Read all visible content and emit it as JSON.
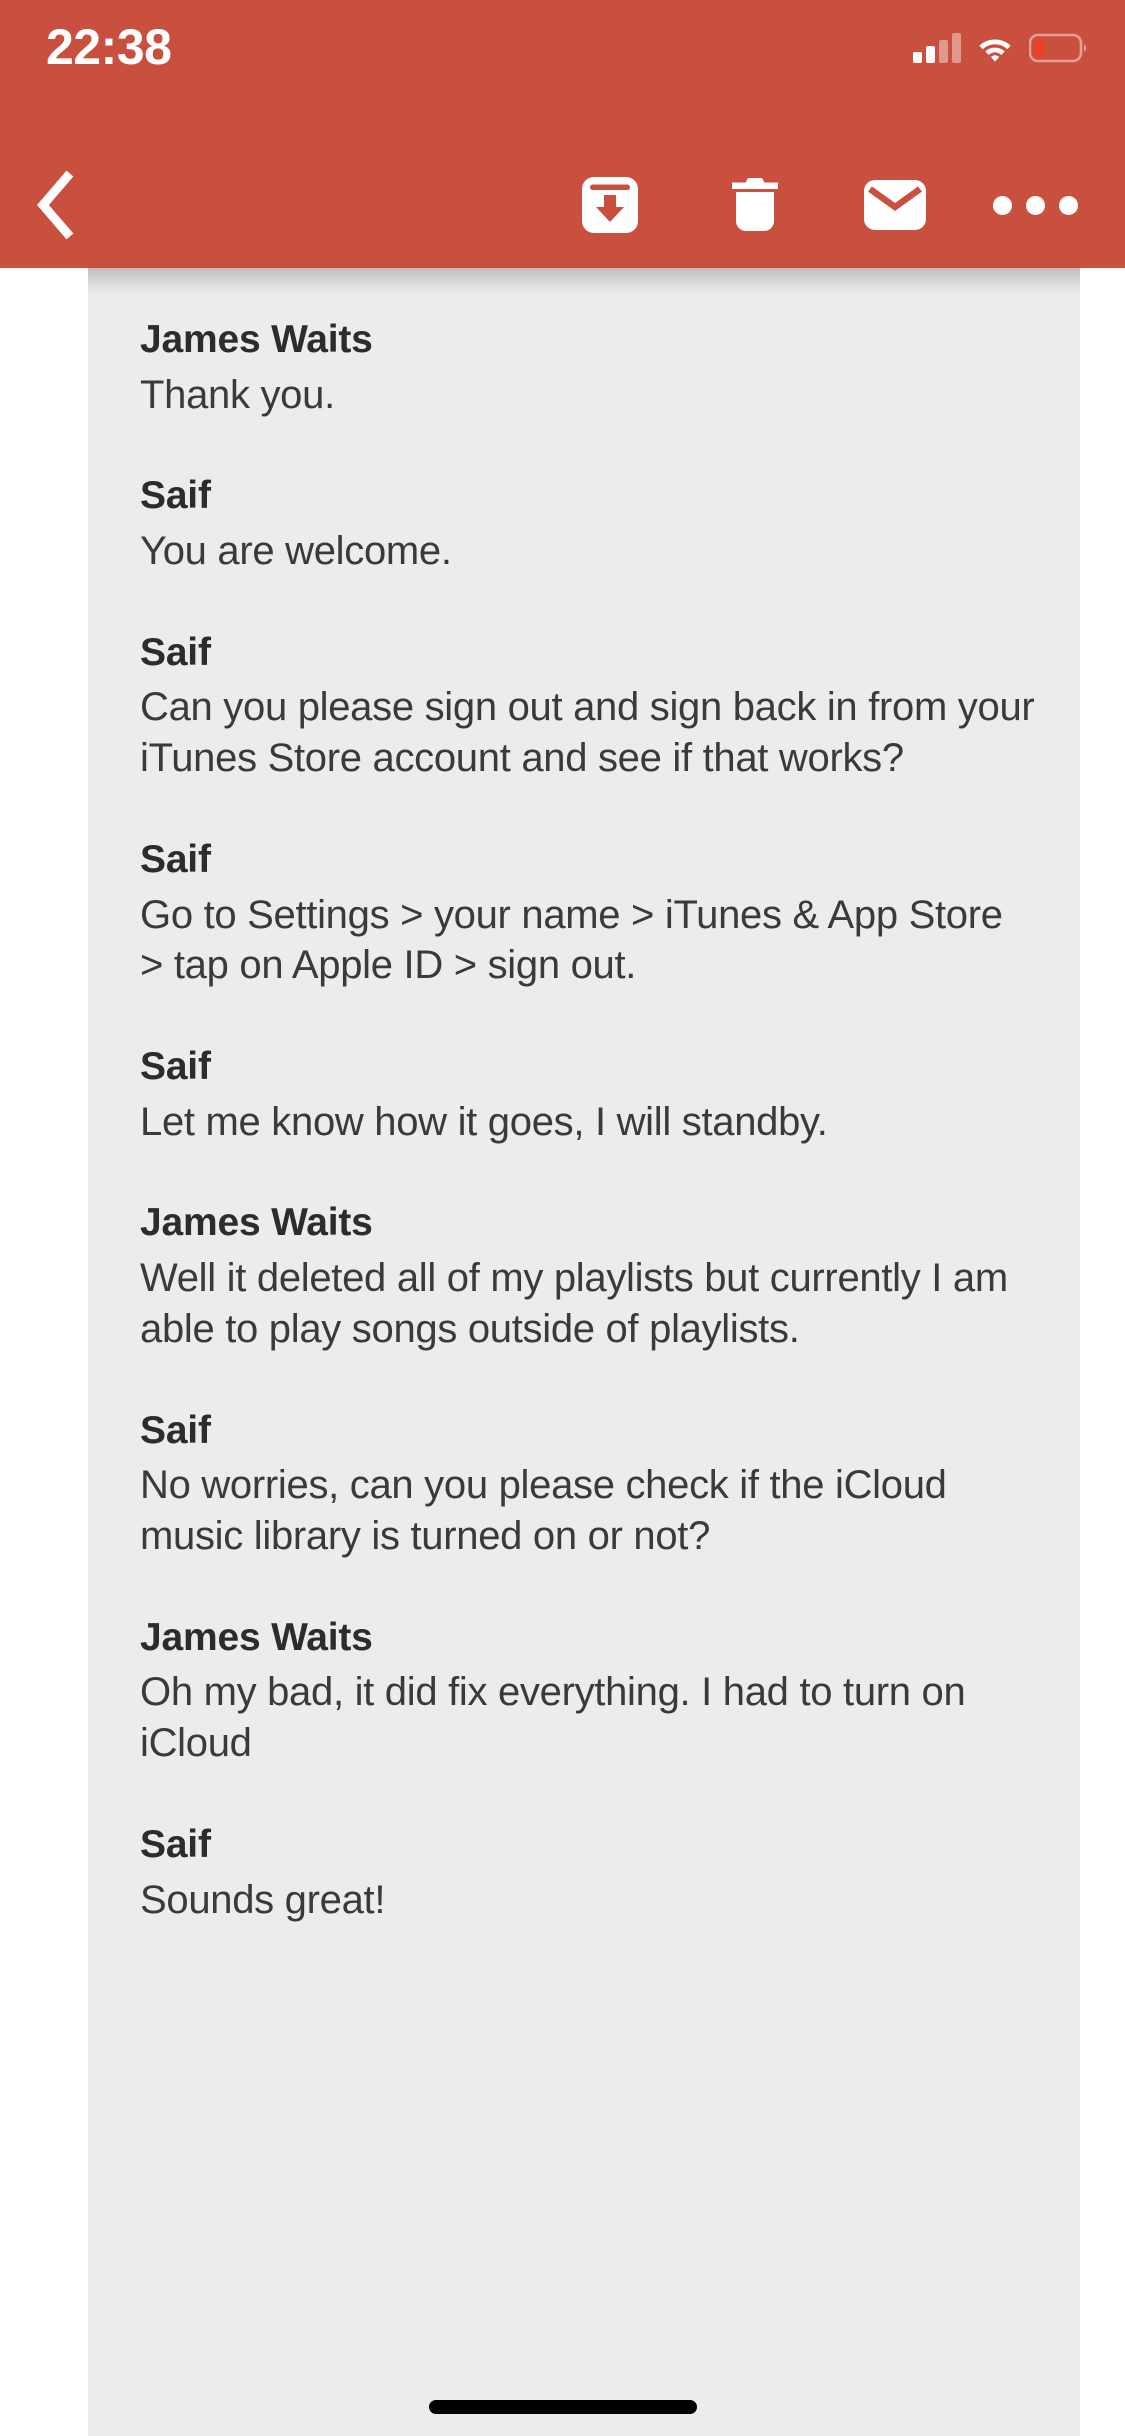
{
  "status_bar": {
    "time": "22:38",
    "cellular_icon": "cellular-signal-icon",
    "wifi_icon": "wifi-icon",
    "battery_icon": "battery-low-icon"
  },
  "toolbar": {
    "background_color": "#c9503f",
    "back_icon": "chevron-left-icon",
    "archive_icon": "archive-download-icon",
    "delete_icon": "trash-icon",
    "mail_icon": "envelope-icon",
    "more_icon": "more-horizontal-icon"
  },
  "content": {
    "background_color": "#ececec",
    "messages": [
      {
        "sender": "James Waits",
        "body": "Thank you."
      },
      {
        "sender": "Saif",
        "body": "You are welcome."
      },
      {
        "sender": "Saif",
        "body": "Can you please sign out and sign back in from your iTunes Store account and see if that works?"
      },
      {
        "sender": "Saif",
        "body": "Go to Settings > your name > iTunes & App Store > tap on Apple ID > sign out."
      },
      {
        "sender": "Saif",
        "body": "Let me know how it goes, I will standby."
      },
      {
        "sender": "James Waits",
        "body": "Well it deleted all of my playlists but currently I am able to play songs outside of playlists."
      },
      {
        "sender": "Saif",
        "body": "No worries, can you please check if the iCloud music library is turned on or not?"
      },
      {
        "sender": "James Waits",
        "body": "Oh my bad, it did fix everything. I had to turn on iCloud"
      },
      {
        "sender": "Saif",
        "body": "Sounds great!"
      }
    ]
  },
  "home_indicator": {
    "label": "home-indicator"
  }
}
